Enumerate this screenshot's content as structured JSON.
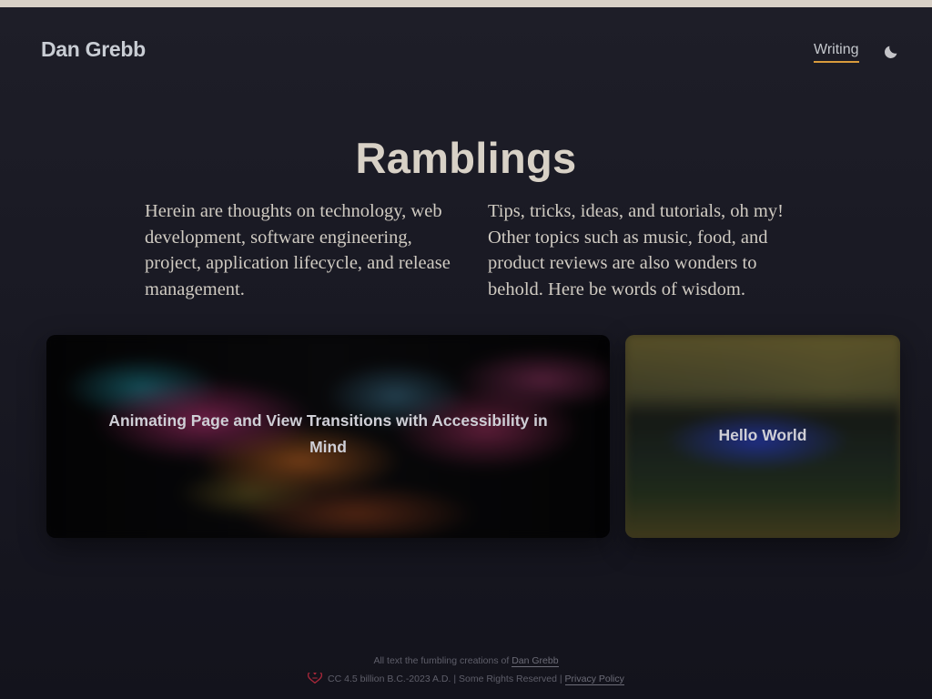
{
  "topbar": {
    "color": "#d8d0c6"
  },
  "header": {
    "brand": "Dan Grebb",
    "nav_writing": "Writing",
    "theme_toggle_icon": "moon-icon",
    "accent_color": "#d99b3c"
  },
  "main": {
    "title": "Ramblings",
    "intro_left": "Herein are thoughts on technology, web development, software engineering, project, application lifecycle, and release management.",
    "intro_right": "Tips, tricks, ideas, and tutorials, oh my! Other topics such as music, food, and product reviews are also wonders to behold. Here be words of wisdom.",
    "cards": [
      {
        "title": "Animating Page and View Transitions with Accessibility in Mind"
      },
      {
        "title": "Hello World"
      }
    ]
  },
  "footer": {
    "line1_prefix": "All text the fumbling creations of",
    "author_link": "Dan Grebb",
    "license_icon": "heart-icon",
    "line2_prefix": "CC 4.5 billion B.C.-2023 A.D. | Some Rights Reserved |",
    "privacy_link": "Privacy Policy"
  }
}
